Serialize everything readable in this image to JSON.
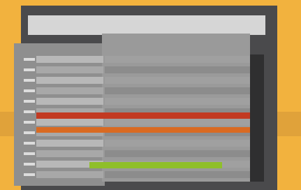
{
  "scene": {
    "description_text": ""
  },
  "colors": {
    "background": "#f2b23e",
    "frame": "#4a4a4c",
    "highlight_red": "#c23a22",
    "highlight_orange": "#d96a22",
    "highlight_green": "#8fbf2a",
    "top_bar": "#d6d6d6"
  },
  "rows": [
    {
      "name": "row-1"
    },
    {
      "name": "row-2"
    },
    {
      "name": "row-3"
    },
    {
      "name": "row-4"
    },
    {
      "name": "row-5"
    },
    {
      "name": "row-6"
    },
    {
      "name": "row-7"
    },
    {
      "name": "row-8"
    },
    {
      "name": "row-9"
    },
    {
      "name": "row-10"
    },
    {
      "name": "row-11"
    },
    {
      "name": "row-12"
    }
  ]
}
